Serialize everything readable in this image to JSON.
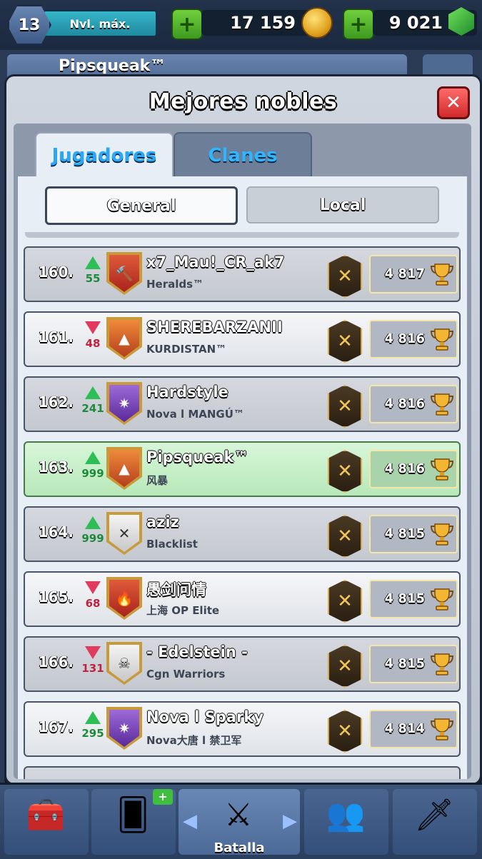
{
  "status_bar": {
    "level": "13",
    "level_label": "Nvl. máx.",
    "gold": "17 159",
    "gems": "9 021",
    "icons": [
      "plus-icon",
      "gold-coin-icon",
      "gem-icon"
    ]
  },
  "background_strip": {
    "player_name": "Pipsqueak™"
  },
  "panel": {
    "title": "Mejores nobles",
    "close_label": "✕",
    "tabs": [
      {
        "label": "Jugadores",
        "active": true
      },
      {
        "label": "Clanes",
        "active": false
      }
    ],
    "segments": [
      {
        "label": "General",
        "active": true
      },
      {
        "label": "Local",
        "active": false
      }
    ]
  },
  "rows": [
    {
      "rank": "160.",
      "direction": "up",
      "change": "55",
      "name": "x7_Mau!_CR_ak7",
      "clan": "Heralds™",
      "trophies": "4 817",
      "badge_icon": "hammer-clan-badge-icon",
      "highlight": false
    },
    {
      "rank": "161.",
      "direction": "down",
      "change": "48",
      "name": "SHEREBARZANII",
      "clan": "KURDISTAN™",
      "trophies": "4 816",
      "badge_icon": "mountain-clan-badge-icon",
      "highlight": false
    },
    {
      "rank": "162.",
      "direction": "up",
      "change": "241",
      "name": "Hardstyle",
      "clan": "Nova l MANGÚ™",
      "trophies": "4 816",
      "badge_icon": "star-clan-badge-icon",
      "highlight": false
    },
    {
      "rank": "163.",
      "direction": "up",
      "change": "999",
      "name": "Pipsqueak™",
      "clan": "风暴",
      "trophies": "4 816",
      "badge_icon": "mountain-clan-badge-icon",
      "highlight": true
    },
    {
      "rank": "164.",
      "direction": "up",
      "change": "999",
      "name": "aziz",
      "clan": "Blacklist",
      "trophies": "4 815",
      "badge_icon": "cross-clan-badge-icon",
      "highlight": false
    },
    {
      "rank": "165.",
      "direction": "down",
      "change": "68",
      "name": "愚剑问情",
      "clan": "上海 OP Elite",
      "trophies": "4 815",
      "badge_icon": "flame-clan-badge-icon",
      "highlight": false
    },
    {
      "rank": "166.",
      "direction": "down",
      "change": "131",
      "name": "- Edelstein -",
      "clan": "Cgn Warriors",
      "trophies": "4 815",
      "badge_icon": "skull-clan-badge-icon",
      "highlight": false
    },
    {
      "rank": "167.",
      "direction": "up",
      "change": "295",
      "name": "Nova l Sparky",
      "clan": "Nova大唐 l 禁卫军",
      "trophies": "4 814",
      "badge_icon": "star-clan-badge-icon",
      "highlight": false
    }
  ],
  "bottom_nav": {
    "items": [
      {
        "icon": "chest-icon",
        "label": ""
      },
      {
        "icon": "cards-icon",
        "label": ""
      },
      {
        "icon": "crossed-swords-icon",
        "label": "Batalla"
      },
      {
        "icon": "clan-members-icon",
        "label": ""
      },
      {
        "icon": "laurel-sword-icon",
        "label": ""
      }
    ]
  }
}
